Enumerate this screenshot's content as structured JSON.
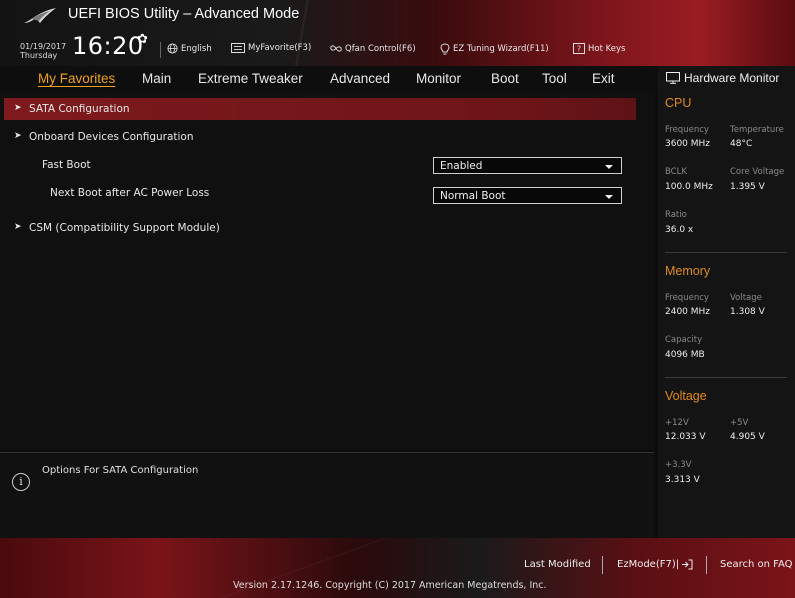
{
  "header": {
    "title": "UEFI BIOS Utility – Advanced Mode",
    "date": "01/19/2017",
    "weekday": "Thursday",
    "time": "16:20",
    "language": "English",
    "myfavorite": "MyFavorite(F3)",
    "qfan": "Qfan Control(F6)",
    "ez_tuning": "EZ Tuning Wizard(F11)",
    "hot_keys": "Hot Keys"
  },
  "nav": {
    "tabs": [
      "My Favorites",
      "Main",
      "Extreme Tweaker",
      "Advanced",
      "Monitor",
      "Boot",
      "Tool",
      "Exit"
    ],
    "active": "My Favorites"
  },
  "main": {
    "items": [
      {
        "label": "SATA Configuration",
        "type": "submenu",
        "selected": true
      },
      {
        "label": "Onboard Devices Configuration",
        "type": "submenu"
      },
      {
        "label": "Fast Boot",
        "type": "setting",
        "value": "Enabled"
      },
      {
        "label": "Next Boot after AC Power Loss",
        "type": "setting",
        "value": "Normal Boot"
      },
      {
        "label": "CSM (Compatibility Support Module)",
        "type": "submenu"
      }
    ]
  },
  "help": {
    "text": "Options For SATA Configuration"
  },
  "hardware_monitor": {
    "title": "Hardware Monitor",
    "cpu": {
      "heading": "CPU",
      "frequency_label": "Frequency",
      "frequency": "3600 MHz",
      "temperature_label": "Temperature",
      "temperature": "48°C",
      "bclk_label": "BCLK",
      "bclk": "100.0 MHz",
      "core_voltage_label": "Core Voltage",
      "core_voltage": "1.395 V",
      "ratio_label": "Ratio",
      "ratio": "36.0 x"
    },
    "memory": {
      "heading": "Memory",
      "frequency_label": "Frequency",
      "frequency": "2400 MHz",
      "voltage_label": "Voltage",
      "voltage": "1.308 V",
      "capacity_label": "Capacity",
      "capacity": "4096 MB"
    },
    "voltage": {
      "heading": "Voltage",
      "v12_label": "+12V",
      "v12": "12.033 V",
      "v5_label": "+5V",
      "v5": "4.905 V",
      "v33_label": "+3.3V",
      "v33": "3.313 V"
    }
  },
  "footer": {
    "last_modified": "Last Modified",
    "ezmode": "EzMode(F7)|",
    "search": "Search on FAQ",
    "copyright": "Version 2.17.1246. Copyright (C) 2017 American Megatrends, Inc."
  },
  "colors": {
    "accent": "#e08a1e",
    "selected_row": "#7e1a1d",
    "brand_red": "#9a1d22"
  }
}
